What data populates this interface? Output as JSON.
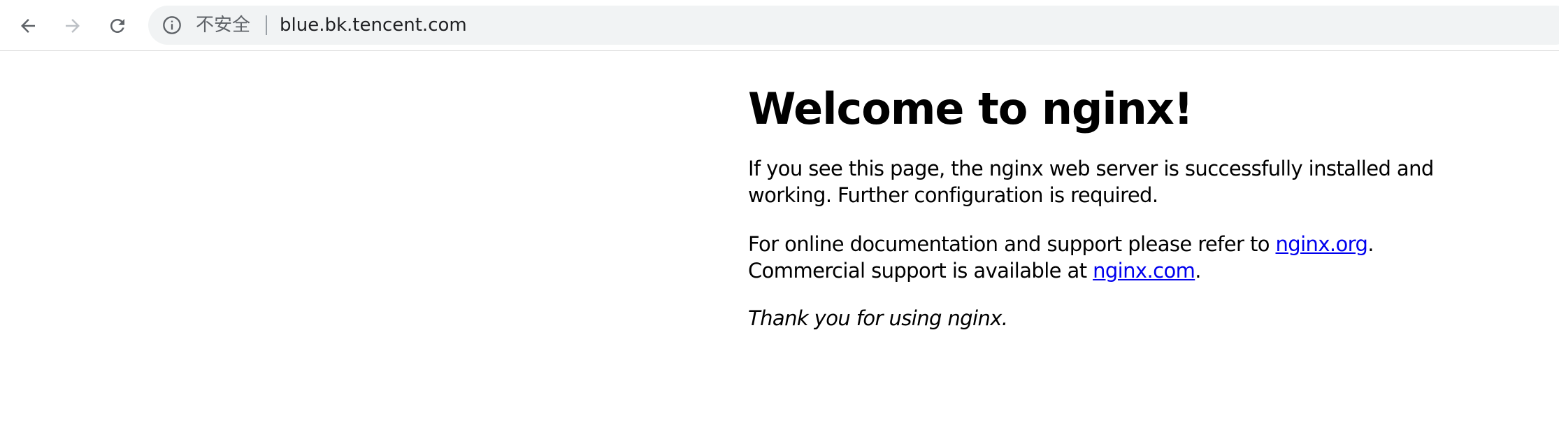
{
  "browser": {
    "back_icon": "arrow-left-icon",
    "forward_icon": "arrow-right-icon",
    "reload_icon": "reload-icon",
    "info_icon": "info-circle-icon",
    "security_label": "不安全",
    "url": "blue.bk.tencent.com"
  },
  "page": {
    "title": "Welcome to nginx!",
    "para1_line1": "If you see this page, the nginx web server is successfully installed and",
    "para1_line2": "working. Further configuration is required.",
    "para2_prefix": "For online documentation and support please refer to ",
    "link_org": "nginx.org",
    "para2_mid": ".",
    "para2_line2_prefix": "Commercial support is available at ",
    "link_com": "nginx.com",
    "para2_end": ".",
    "thanks": "Thank you for using nginx."
  },
  "colors": {
    "link": "#0000ee",
    "omnibox_bg": "#f1f3f4",
    "icon_gray": "#5f6368",
    "disabled_gray": "#bdc1c6"
  }
}
